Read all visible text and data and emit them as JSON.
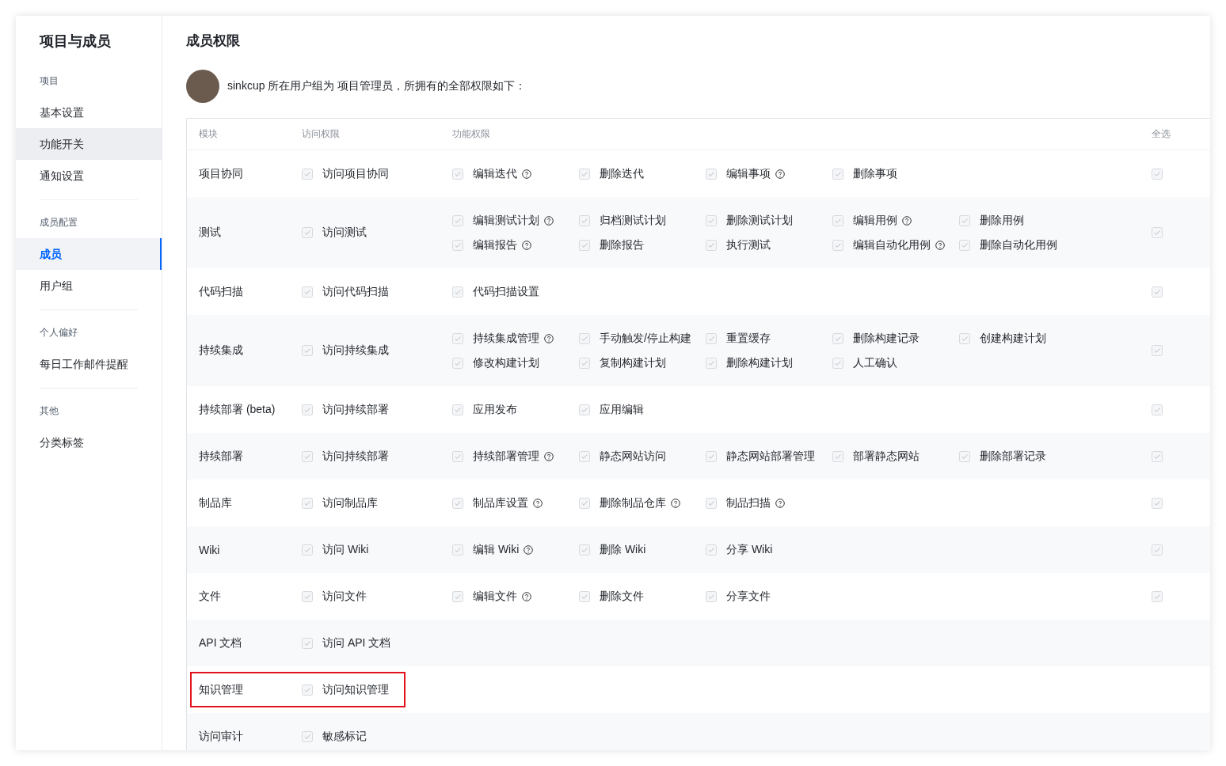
{
  "sidebar": {
    "title": "项目与成员",
    "groups": [
      {
        "label": "项目",
        "items": [
          {
            "label": "基本设置",
            "selected": false,
            "hovered": false
          },
          {
            "label": "功能开关",
            "selected": false,
            "hovered": true
          },
          {
            "label": "通知设置",
            "selected": false,
            "hovered": false
          }
        ]
      },
      {
        "label": "成员配置",
        "items": [
          {
            "label": "成员",
            "selected": true,
            "hovered": false
          },
          {
            "label": "用户组",
            "selected": false,
            "hovered": false
          }
        ]
      },
      {
        "label": "个人偏好",
        "items": [
          {
            "label": "每日工作邮件提醒",
            "selected": false,
            "hovered": false
          }
        ]
      },
      {
        "label": "其他",
        "items": [
          {
            "label": "分类标签",
            "selected": false,
            "hovered": false
          }
        ]
      }
    ]
  },
  "main": {
    "title": "成员权限",
    "summary": "sinkcup 所在用户组为 项目管理员，所拥有的全部权限如下："
  },
  "table": {
    "columns": [
      "模块",
      "访问权限",
      "功能权限",
      "全选"
    ],
    "rows": [
      {
        "module": "项目协同",
        "highlighted": false,
        "access": {
          "label": "访问项目协同",
          "checked": true
        },
        "functions": [
          {
            "label": "编辑迭代",
            "checked": true,
            "help": true
          },
          {
            "label": "删除迭代",
            "checked": true,
            "help": false
          },
          {
            "label": "编辑事项",
            "checked": true,
            "help": true
          },
          {
            "label": "删除事项",
            "checked": true,
            "help": false
          }
        ],
        "select_all": {
          "checked": true
        }
      },
      {
        "module": "测试",
        "highlighted": false,
        "access": {
          "label": "访问测试",
          "checked": true
        },
        "functions": [
          {
            "label": "编辑测试计划",
            "checked": true,
            "help": true
          },
          {
            "label": "归档测试计划",
            "checked": true,
            "help": false
          },
          {
            "label": "删除测试计划",
            "checked": true,
            "help": false
          },
          {
            "label": "编辑用例",
            "checked": true,
            "help": true
          },
          {
            "label": "删除用例",
            "checked": true,
            "help": false
          },
          {
            "label": "编辑报告",
            "checked": true,
            "help": true
          },
          {
            "label": "删除报告",
            "checked": true,
            "help": false
          },
          {
            "label": "执行测试",
            "checked": true,
            "help": false
          },
          {
            "label": "编辑自动化用例",
            "checked": true,
            "help": true
          },
          {
            "label": "删除自动化用例",
            "checked": true,
            "help": false
          }
        ],
        "select_all": {
          "checked": true
        }
      },
      {
        "module": "代码扫描",
        "highlighted": false,
        "access": {
          "label": "访问代码扫描",
          "checked": true
        },
        "functions": [
          {
            "label": "代码扫描设置",
            "checked": true,
            "help": false
          }
        ],
        "select_all": {
          "checked": true
        }
      },
      {
        "module": "持续集成",
        "highlighted": false,
        "access": {
          "label": "访问持续集成",
          "checked": true
        },
        "functions": [
          {
            "label": "持续集成管理",
            "checked": true,
            "help": true
          },
          {
            "label": "手动触发/停止构建",
            "checked": true,
            "help": false
          },
          {
            "label": "重置缓存",
            "checked": true,
            "help": false
          },
          {
            "label": "删除构建记录",
            "checked": true,
            "help": false
          },
          {
            "label": "创建构建计划",
            "checked": true,
            "help": false
          },
          {
            "label": "修改构建计划",
            "checked": true,
            "help": false
          },
          {
            "label": "复制构建计划",
            "checked": true,
            "help": false
          },
          {
            "label": "删除构建计划",
            "checked": true,
            "help": false
          },
          {
            "label": "人工确认",
            "checked": true,
            "help": false
          }
        ],
        "select_all": {
          "checked": true
        }
      },
      {
        "module": "持续部署 (beta)",
        "highlighted": false,
        "access": {
          "label": "访问持续部署",
          "checked": true
        },
        "functions": [
          {
            "label": "应用发布",
            "checked": true,
            "help": false
          },
          {
            "label": "应用编辑",
            "checked": true,
            "help": false
          }
        ],
        "select_all": {
          "checked": true
        }
      },
      {
        "module": "持续部署",
        "highlighted": false,
        "access": {
          "label": "访问持续部署",
          "checked": true
        },
        "functions": [
          {
            "label": "持续部署管理",
            "checked": true,
            "help": true
          },
          {
            "label": "静态网站访问",
            "checked": true,
            "help": false
          },
          {
            "label": "静态网站部署管理",
            "checked": true,
            "help": false
          },
          {
            "label": "部署静态网站",
            "checked": true,
            "help": false
          },
          {
            "label": "删除部署记录",
            "checked": true,
            "help": false
          }
        ],
        "select_all": {
          "checked": true
        }
      },
      {
        "module": "制品库",
        "highlighted": false,
        "access": {
          "label": "访问制品库",
          "checked": true
        },
        "functions": [
          {
            "label": "制品库设置",
            "checked": true,
            "help": true
          },
          {
            "label": "删除制品仓库",
            "checked": true,
            "help": true
          },
          {
            "label": "制品扫描",
            "checked": true,
            "help": true
          }
        ],
        "select_all": {
          "checked": true
        }
      },
      {
        "module": "Wiki",
        "highlighted": false,
        "access": {
          "label": "访问 Wiki",
          "checked": true
        },
        "functions": [
          {
            "label": "编辑 Wiki",
            "checked": true,
            "help": true
          },
          {
            "label": "删除 Wiki",
            "checked": true,
            "help": false
          },
          {
            "label": "分享 Wiki",
            "checked": true,
            "help": false
          }
        ],
        "select_all": {
          "checked": true
        }
      },
      {
        "module": "文件",
        "highlighted": false,
        "access": {
          "label": "访问文件",
          "checked": true
        },
        "functions": [
          {
            "label": "编辑文件",
            "checked": true,
            "help": true
          },
          {
            "label": "删除文件",
            "checked": true,
            "help": false
          },
          {
            "label": "分享文件",
            "checked": true,
            "help": false
          }
        ],
        "select_all": {
          "checked": true
        }
      },
      {
        "module": "API 文档",
        "highlighted": false,
        "access": {
          "label": "访问 API 文档",
          "checked": true
        },
        "functions": []
      },
      {
        "module": "知识管理",
        "highlighted": true,
        "access": {
          "label": "访问知识管理",
          "checked": true
        },
        "functions": []
      },
      {
        "module": "访问审计",
        "highlighted": false,
        "access": {
          "label": "敏感标记",
          "checked": true
        },
        "functions": []
      }
    ]
  }
}
